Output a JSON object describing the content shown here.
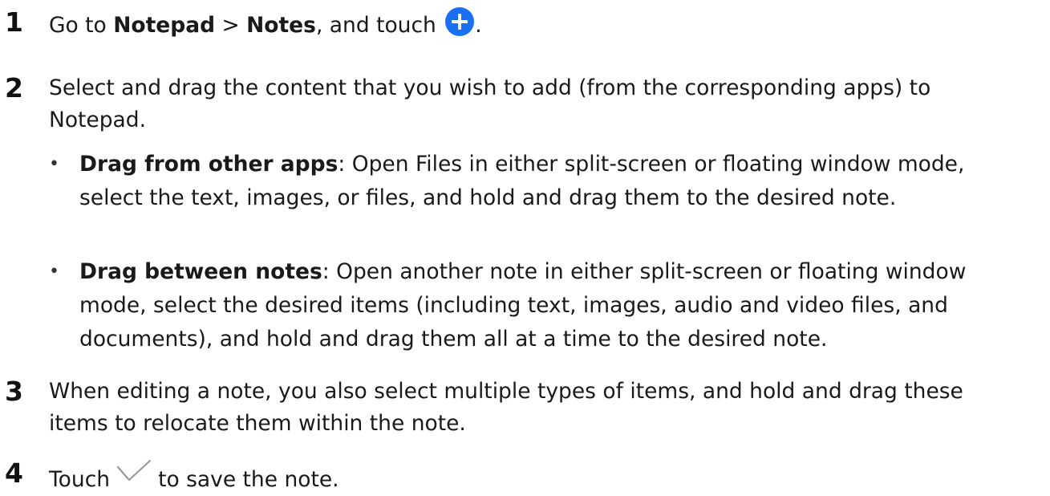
{
  "steps": [
    {
      "number": "1",
      "pre": "Go to ",
      "app": "Notepad",
      "sep": " > ",
      "section": "Notes",
      "post": ", and touch ",
      "icon": "plus-circle-icon",
      "end": "."
    },
    {
      "number": "2",
      "line1": "Select and drag the content that you wish to add (from the corresponding apps) to",
      "line2": "Notepad.",
      "bullets": [
        {
          "title": "Drag from other apps",
          "line1": ": Open Files in either split-screen or floating window mode,",
          "line2": "select the text, images, or files, and hold and drag them to the desired note."
        },
        {
          "title": "Drag between notes",
          "line1": ": Open another note in either split-screen or floating window",
          "line2": "mode, select the desired items (including text, images, audio and video files, and",
          "line3": "documents), and hold and drag them all at a time to the desired note."
        }
      ]
    },
    {
      "number": "3",
      "line1": "When editing a note, you also select multiple types of items, and hold and drag these",
      "line2": "items to relocate them within the note."
    },
    {
      "number": "4",
      "pre": "Touch",
      "icon": "checkmark-icon",
      "post": "to save the note."
    }
  ],
  "colors": {
    "accent": "#1a6ff2",
    "text": "#1a1a1a",
    "icon_gray": "#9a9a9a"
  }
}
